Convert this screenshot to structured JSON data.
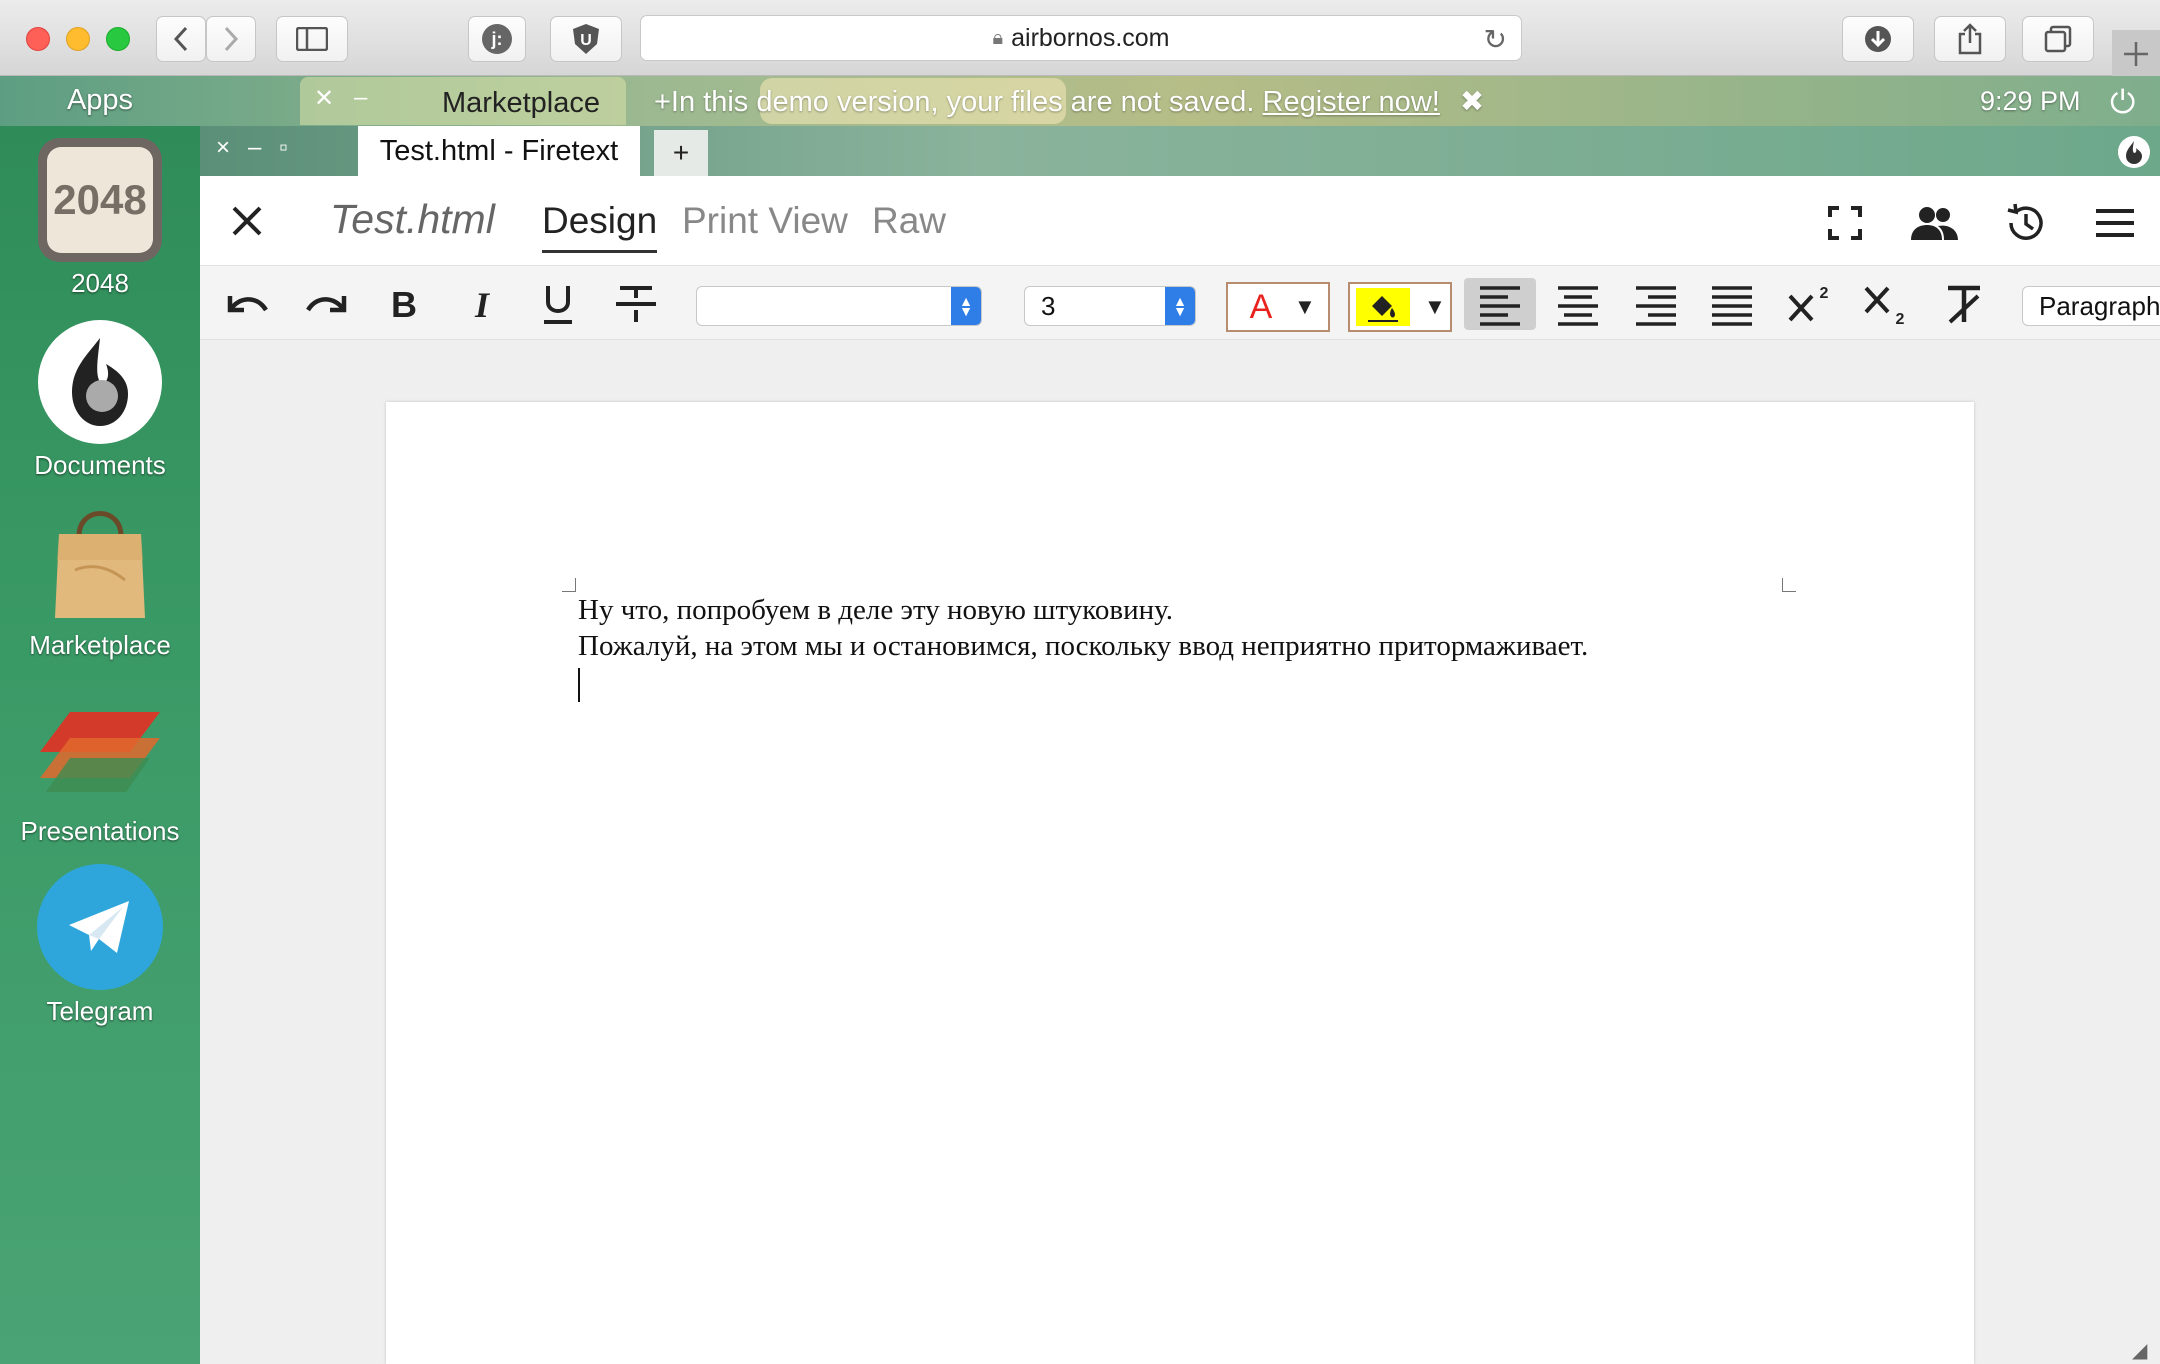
{
  "browser": {
    "url": "airbornos.com"
  },
  "desktop": {
    "apps_label": "Apps",
    "clock": "9:29 PM",
    "taskbar": {
      "marketplace_label": "Marketplace"
    },
    "banner": {
      "text": "+In this demo version, your files are not saved.",
      "link": "Register now!",
      "close": "✖"
    },
    "sidebar_apps": [
      {
        "label": "2048",
        "icon_text": "2048"
      },
      {
        "label": "Documents"
      },
      {
        "label": "Marketplace"
      },
      {
        "label": "Presentations"
      },
      {
        "label": "Telegram"
      }
    ]
  },
  "window": {
    "tab_title": "Test.html - Firetext",
    "new_tab": "+",
    "controls": "×–▫"
  },
  "editor": {
    "doc_title": "Test.html",
    "tabs": [
      "Design",
      "Print View",
      "Raw"
    ],
    "active_tab": "Design",
    "toolbar": {
      "font_value": "",
      "size_value": "3",
      "text_color_glyph": "A",
      "text_color": "#e8231e",
      "highlight_color": "#ffff00",
      "paragraph_value": "Paragraph"
    },
    "content": [
      "Ну что, попробуем в деле эту новую штуковину.",
      "Пожалуй, на этом мы и остановимся, поскольку ввод неприятно притормаживает."
    ]
  }
}
